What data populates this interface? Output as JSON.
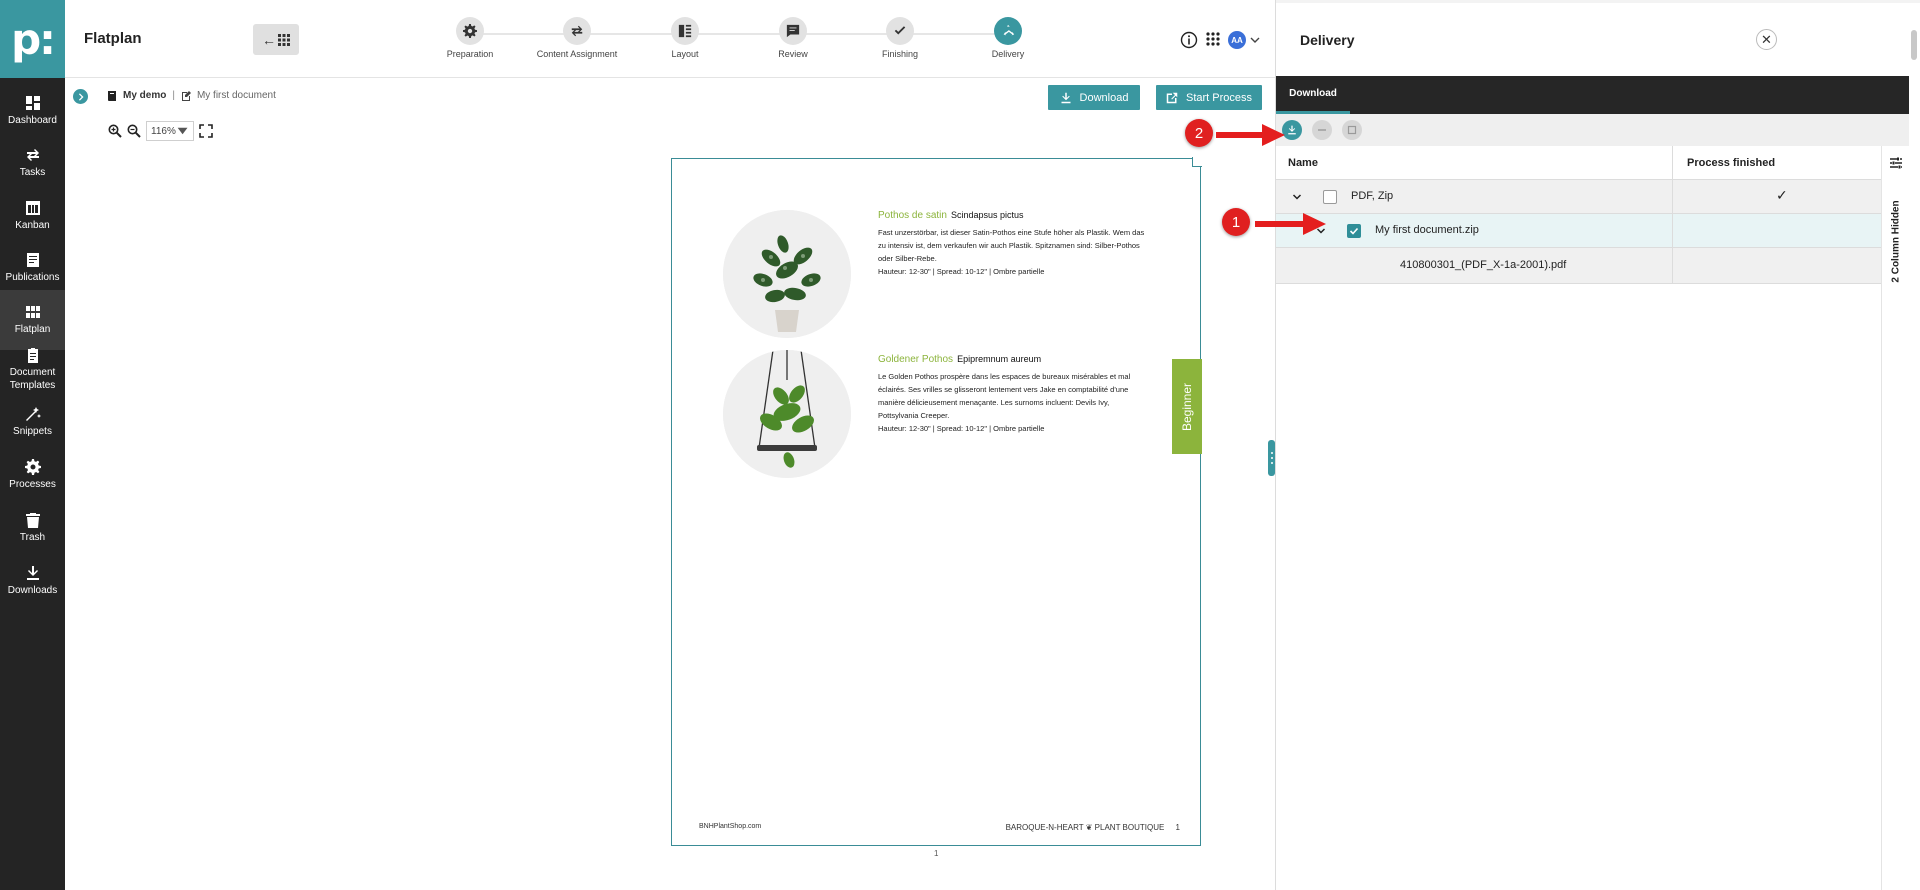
{
  "app": {
    "title": "Flatplan",
    "logo": "p:"
  },
  "rail": {
    "items": [
      {
        "label": "Dashboard",
        "icon": "dashboard-icon"
      },
      {
        "label": "Tasks",
        "icon": "tasks-icon"
      },
      {
        "label": "Kanban",
        "icon": "kanban-icon"
      },
      {
        "label": "Publications",
        "icon": "publications-icon"
      },
      {
        "label": "Flatplan",
        "icon": "flatplan-icon",
        "active": true
      },
      {
        "label": "Document Templates",
        "icon": "templates-icon"
      },
      {
        "label": "Snippets",
        "icon": "snippets-icon"
      },
      {
        "label": "Processes",
        "icon": "processes-icon"
      },
      {
        "label": "Trash",
        "icon": "trash-icon"
      },
      {
        "label": "Downloads",
        "icon": "downloads-icon"
      }
    ]
  },
  "header": {
    "back_button": "←",
    "steps": [
      {
        "label": "Preparation",
        "icon": "gear-icon"
      },
      {
        "label": "Content Assignment",
        "icon": "swap-icon"
      },
      {
        "label": "Layout",
        "icon": "layout-icon"
      },
      {
        "label": "Review",
        "icon": "comment-icon"
      },
      {
        "label": "Finishing",
        "icon": "check-icon"
      },
      {
        "label": "Delivery",
        "icon": "delivery-icon",
        "active": true
      }
    ],
    "avatar": "AA"
  },
  "subbar": {
    "breadcrumb": [
      "My demo",
      "My first document"
    ],
    "separator": "|",
    "download_label": "Download",
    "start_process_label": "Start Process",
    "zoom": "116%"
  },
  "page": {
    "plants": [
      {
        "name": "Pothos de satin",
        "latin": "Scindapsus pictus",
        "description": "Fast unzerstörbar, ist dieser Satin-Pothos eine Stufe höher als Plastik. Wem das zu intensiv ist, dem verkaufen wir auch Plastik. Spitznamen sind: Silber-Pothos oder Silber-Rebe.",
        "specs": "Hauteur: 12-30\" | Spread: 10-12\" | Ombre partielle"
      },
      {
        "name": "Goldener Pothos",
        "latin": "Epipremnum aureum",
        "description": "Le Golden Pothos prospère dans les espaces de bureaux misérables et mal éclairés. Ses vrilles se glisseront lentement vers Jake en comptabilité d'une manière délicieusement menaçante. Les surnoms incluent: Devils Ivy, Pottsylvania Creeper.",
        "specs": "Hauteur: 12-30\" | Spread: 10-12\" | Ombre partielle"
      }
    ],
    "tab_label": "Beginner",
    "footer_left": "BNHPlantShop.com",
    "footer_right": "BAROQUE-N-HEART ❦ PLANT BOUTIQUE",
    "footer_page": "1",
    "page_number_below": "1"
  },
  "annotations": {
    "badge1": "1",
    "badge2": "2"
  },
  "panel": {
    "title": "Delivery",
    "close": "✕",
    "tab": "Download",
    "columns": {
      "name": "Name",
      "process_finished": "Process finished"
    },
    "rows": [
      {
        "name": "PDF, Zip",
        "process_finished": "✓",
        "checked": false,
        "level": 0
      },
      {
        "name": "My first document.zip",
        "process_finished": "",
        "checked": true,
        "level": 1
      },
      {
        "name": "410800301_(PDF_X-1a-2001).pdf",
        "process_finished": "",
        "level": 2
      }
    ],
    "hidden_columns_label": "2 Column Hidden"
  },
  "colors": {
    "accent": "#3a97a0",
    "rail": "#242424",
    "leaf_green": "#8cb43c",
    "annotation_red": "#e02020"
  }
}
